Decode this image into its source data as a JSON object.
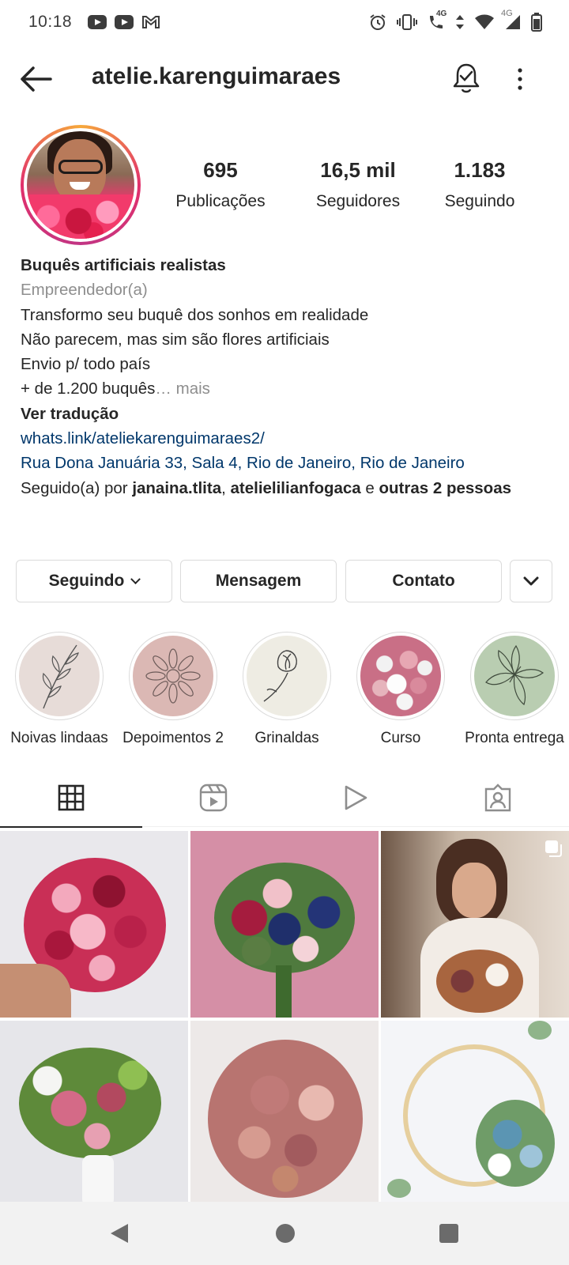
{
  "status_bar": {
    "time": "10:18",
    "network_labels": [
      "4G",
      "4G"
    ],
    "icons": [
      "youtube-icon",
      "youtube-icon",
      "gmail-icon",
      "alarm-icon",
      "vibrate-icon",
      "call-4g-icon",
      "data-icon",
      "wifi-icon",
      "signal-icon",
      "battery-icon"
    ]
  },
  "header": {
    "username": "atelie.karenguimaraes",
    "icons": [
      "back-arrow-icon",
      "notification-bell-icon",
      "more-options-icon"
    ]
  },
  "stats": {
    "posts": {
      "value": "695",
      "label": "Publicações"
    },
    "followers": {
      "value": "16,5 mil",
      "label": "Seguidores"
    },
    "following": {
      "value": "1.183",
      "label": "Seguindo"
    }
  },
  "bio": {
    "name": "Buquês artificiais realistas",
    "category": "Empreendedor(a)",
    "lines": [
      "Transformo seu buquê dos sonhos em realidade",
      "Não parecem, mas sim são flores artificiais",
      "Envio p/ todo país"
    ],
    "truncated_line": "+ de 1.200 buquês",
    "more_label": "… mais",
    "translate_label": "Ver tradução",
    "link": "whats.link/ateliekarenguimaraes2/",
    "address": "Rua Dona Januária 33, Sala 4, Rio de Janeiro, Rio de Janeiro",
    "followed_by": {
      "prefix": "Seguido(a) por ",
      "user1": "janaina.tlita",
      "sep": ", ",
      "user2": "atelielilianfogaca",
      "conj": " e ",
      "others": "outras 2 pessoas"
    }
  },
  "actions": {
    "following": "Seguindo",
    "message": "Mensagem",
    "contact": "Contato"
  },
  "highlights": [
    {
      "label": "Noivas lindaas",
      "icon": "leaf-branch-icon",
      "bg": "#e7dcd8"
    },
    {
      "label": "Depoimentos 2",
      "icon": "daisy-icon",
      "bg": "#dbb8b4"
    },
    {
      "label": "Grinaldas",
      "icon": "rose-bud-icon",
      "bg": "#eeece3"
    },
    {
      "label": "Curso",
      "icon": "bouquet-photo",
      "bg": "#e8e3e3"
    },
    {
      "label": "Pronta entrega",
      "icon": "lily-icon",
      "bg": "#b9cdb1"
    }
  ],
  "tabs": [
    "grid-icon",
    "reels-icon",
    "video-play-icon",
    "tagged-icon"
  ],
  "posts": [
    {
      "name": "post-red-pink-bouquet",
      "bg": "#e9e8ec",
      "main": "#b9214a",
      "accent": "#f3a9bd"
    },
    {
      "name": "post-navy-pink-bouquet",
      "bg": "#d58fa6",
      "main": "#1f2f6b",
      "accent": "#f1c1c9"
    },
    {
      "name": "post-bride-photo",
      "bg": "#c8b7a6",
      "main": "#6a4a3c",
      "accent": "#f2ece6"
    },
    {
      "name": "post-green-pink-bouquet",
      "bg": "#e6e6ea",
      "main": "#d46a87",
      "accent": "#8fbf52"
    },
    {
      "name": "post-dusty-rose-bouquet",
      "bg": "#ede9e8",
      "main": "#c07a78",
      "accent": "#e8b9b0"
    },
    {
      "name": "post-hoop-wreath",
      "bg": "#f4f5f8",
      "main": "#5b95b3",
      "accent": "#e6cf9e"
    }
  ]
}
